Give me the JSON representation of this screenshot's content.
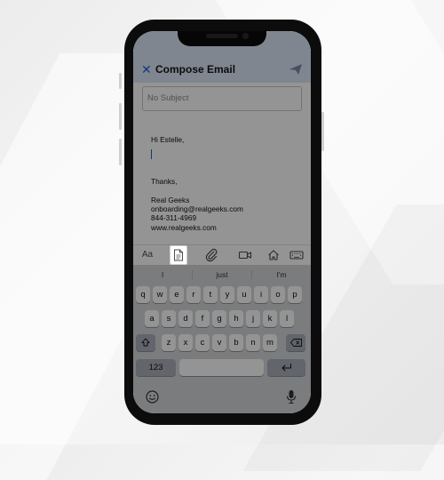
{
  "header": {
    "title": "Compose Email",
    "close_icon": "x-icon",
    "send_icon": "paper-plane-icon",
    "accent": "#1f5fd1"
  },
  "subject": {
    "placeholder": "No Subject"
  },
  "message": {
    "greeting": "Hi Estelle,",
    "closing": "Thanks,",
    "signature": [
      "Real Geeks",
      "onboarding@realgeeks.com",
      "844-311-4969",
      "www.realgeeks.com"
    ]
  },
  "toolbar": {
    "text_format_label": "Aa",
    "items": [
      "text-format-icon",
      "document-icon",
      "attachment-icon",
      "video-icon",
      "home-icon",
      "keyboard-icon"
    ],
    "selected": "document-icon"
  },
  "keyboard": {
    "suggestions": [
      "I",
      "just",
      "I'm"
    ],
    "row1": [
      "q",
      "w",
      "e",
      "r",
      "t",
      "y",
      "u",
      "i",
      "o",
      "p"
    ],
    "row2": [
      "a",
      "s",
      "d",
      "f",
      "g",
      "h",
      "j",
      "k",
      "l"
    ],
    "row3": [
      "z",
      "x",
      "c",
      "v",
      "b",
      "n",
      "m"
    ],
    "numbers_label": "123",
    "icons": [
      "shift-icon",
      "backspace-icon",
      "return-icon",
      "emoji-icon",
      "microphone-icon"
    ]
  }
}
